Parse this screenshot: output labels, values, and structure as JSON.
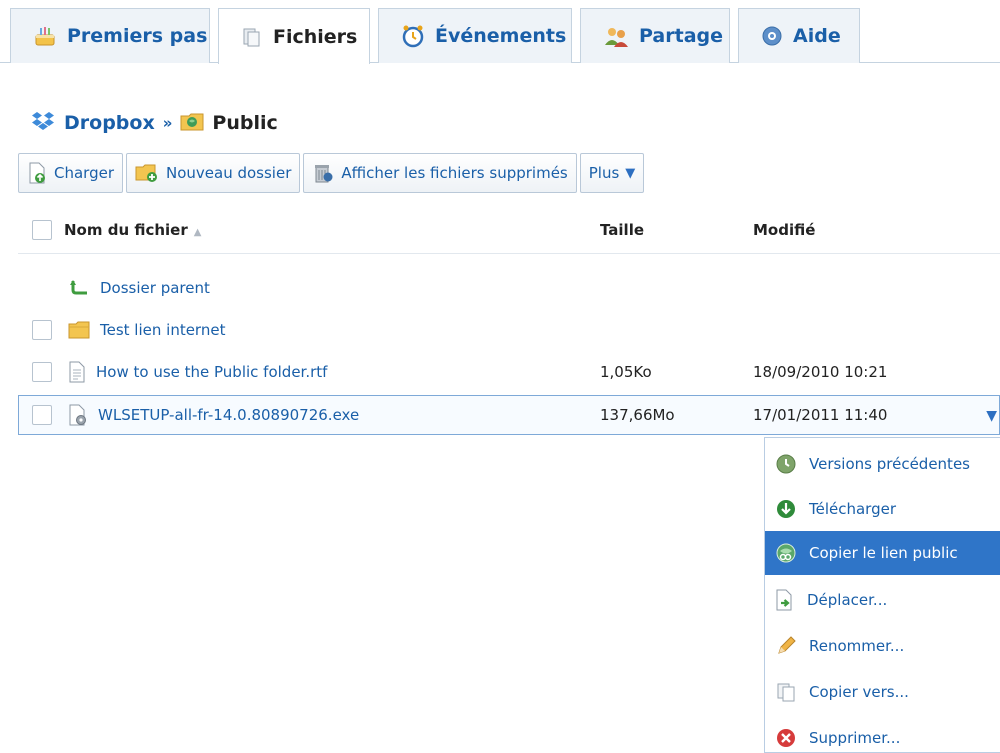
{
  "tabs": [
    {
      "label": "Premiers pas",
      "icon": "cake-icon",
      "active": false
    },
    {
      "label": "Fichiers",
      "icon": "files-icon",
      "active": true
    },
    {
      "label": "Événements",
      "icon": "clock-icon",
      "active": false
    },
    {
      "label": "Partage",
      "icon": "people-icon",
      "active": false
    },
    {
      "label": "Aide",
      "icon": "help-icon",
      "active": false
    }
  ],
  "breadcrumb": {
    "root": "Dropbox",
    "separator": "»",
    "current": "Public"
  },
  "toolbar": {
    "upload": "Charger",
    "new_folder": "Nouveau dossier",
    "show_deleted": "Afficher les fichiers supprimés",
    "more": "Plus"
  },
  "table": {
    "headers": {
      "name": "Nom du fichier",
      "size": "Taille",
      "modified": "Modifié"
    },
    "parent": "Dossier parent",
    "rows": [
      {
        "name": "Test lien internet",
        "type": "folder",
        "size": "",
        "modified": ""
      },
      {
        "name": "How to use the Public folder.rtf",
        "type": "document",
        "size": "1,05Ko",
        "modified": "18/09/2010 10:21"
      },
      {
        "name": "WLSETUP-all-fr-14.0.80890726.exe",
        "type": "executable",
        "size": "137,66Mo",
        "modified": "17/01/2011 11:40",
        "selected": true
      }
    ]
  },
  "context_menu": {
    "items": [
      {
        "label": "Versions précédentes",
        "icon": "history-icon"
      },
      {
        "label": "Télécharger",
        "icon": "download-icon"
      },
      {
        "label": "Copier le lien public",
        "icon": "public-link-icon",
        "highlighted": true
      },
      {
        "label": "Déplacer...",
        "icon": "move-icon"
      },
      {
        "label": "Renommer...",
        "icon": "rename-icon"
      },
      {
        "label": "Copier vers...",
        "icon": "copy-icon"
      },
      {
        "label": "Supprimer...",
        "icon": "delete-icon"
      }
    ]
  },
  "colors": {
    "link": "#1a5fa8",
    "highlight": "#2f75c8",
    "border": "#b9c8d8"
  }
}
